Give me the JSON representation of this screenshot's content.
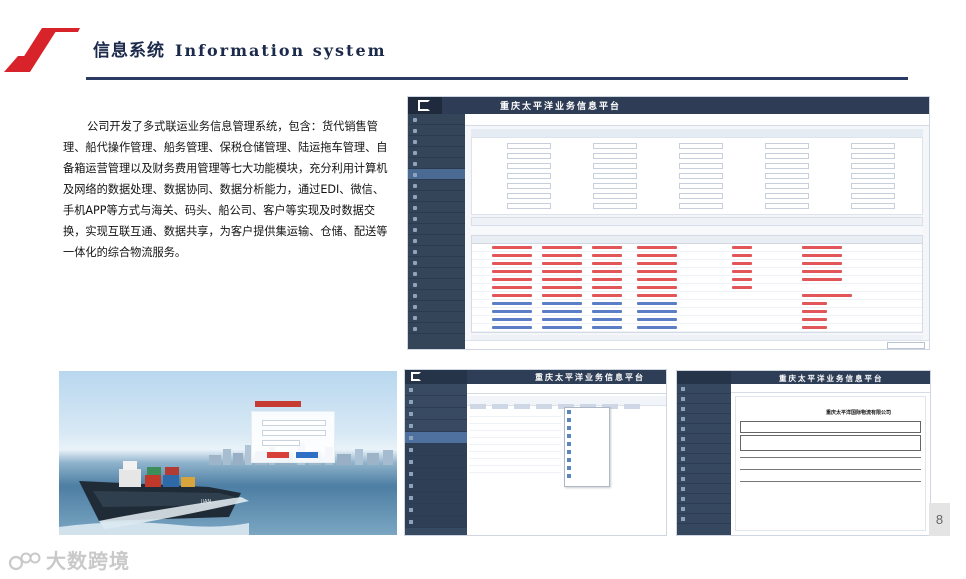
{
  "header": {
    "title_cn": "信息系统",
    "title_en": "Information system"
  },
  "description": "公司开发了多式联运业务信息管理系统，包含：货代销售管理、船代操作管理、船务管理、保税仓储管理、陆运拖车管理、自备箱运营管理以及财务费用管理等七大功能模块，充分利用计算机及网络的数据处理、数据协同、数据分析能力，通过EDI、微信、手机APP等方式与海关、码头、船公司、客户等实现及时数据交换，实现互联互通、数据共享，为客户提供集运输、仓储、配送等一体化的综合物流服务。",
  "main_screenshot": {
    "app_title": "重庆太平洋业务信息平台"
  },
  "dropdown_screenshot": {
    "app_title": "重庆太平洋业务信息平台"
  },
  "document_screenshot": {
    "app_title": "重庆太平洋业务信息平台",
    "doc_heading": "重庆太平洋国际物流有限公司"
  },
  "page_number": "8",
  "watermark": {
    "text": "大数跨境"
  },
  "colors": {
    "accent_red": "#d8232a",
    "navy": "#2b3a63",
    "sidebar": "#344459"
  }
}
